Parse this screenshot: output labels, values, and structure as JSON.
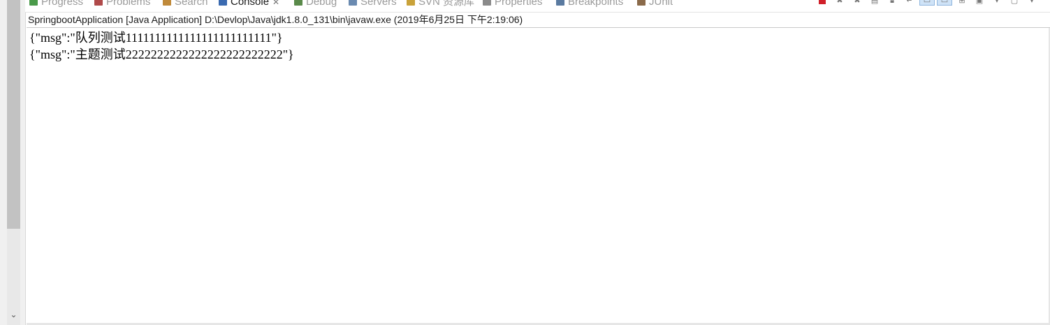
{
  "tabs": [
    {
      "label": "Progress",
      "icon": "progress-icon",
      "color": "#4a9a4a",
      "active": false
    },
    {
      "label": "Problems",
      "icon": "problems-icon",
      "color": "#b04a4a",
      "active": false
    },
    {
      "label": "Search",
      "icon": "search-icon",
      "color": "#c08a3a",
      "active": false
    },
    {
      "label": "Console",
      "icon": "console-icon",
      "color": "#3a6ab0",
      "active": true
    },
    {
      "label": "Debug",
      "icon": "debug-icon",
      "color": "#5a8a4a",
      "active": false
    },
    {
      "label": "Servers",
      "icon": "servers-icon",
      "color": "#6a8ab0",
      "active": false
    },
    {
      "label": "SVN 资源库",
      "icon": "svn-icon",
      "color": "#c9a23a",
      "active": false
    },
    {
      "label": "Properties",
      "icon": "properties-icon",
      "color": "#8a8a8a",
      "active": false
    },
    {
      "label": "Breakpoints",
      "icon": "breakpoints-icon",
      "color": "#5a7aa0",
      "active": false
    },
    {
      "label": "JUnit",
      "icon": "junit-icon",
      "color": "#8a6a4a",
      "active": false
    }
  ],
  "colors": {
    "terminate": "#d0202a",
    "accent_selected": "#cfe3f7"
  },
  "console": {
    "header": "SpringbootApplication [Java Application] D:\\Devlop\\Java\\jdk1.8.0_131\\bin\\javaw.exe (2019年6月25日 下午2:19:06)",
    "lines": [
      "{\"msg\":\"队列测试1111111111111111111111111\"}",
      "{\"msg\":\"主题测试2222222222222222222222222\"}"
    ]
  }
}
